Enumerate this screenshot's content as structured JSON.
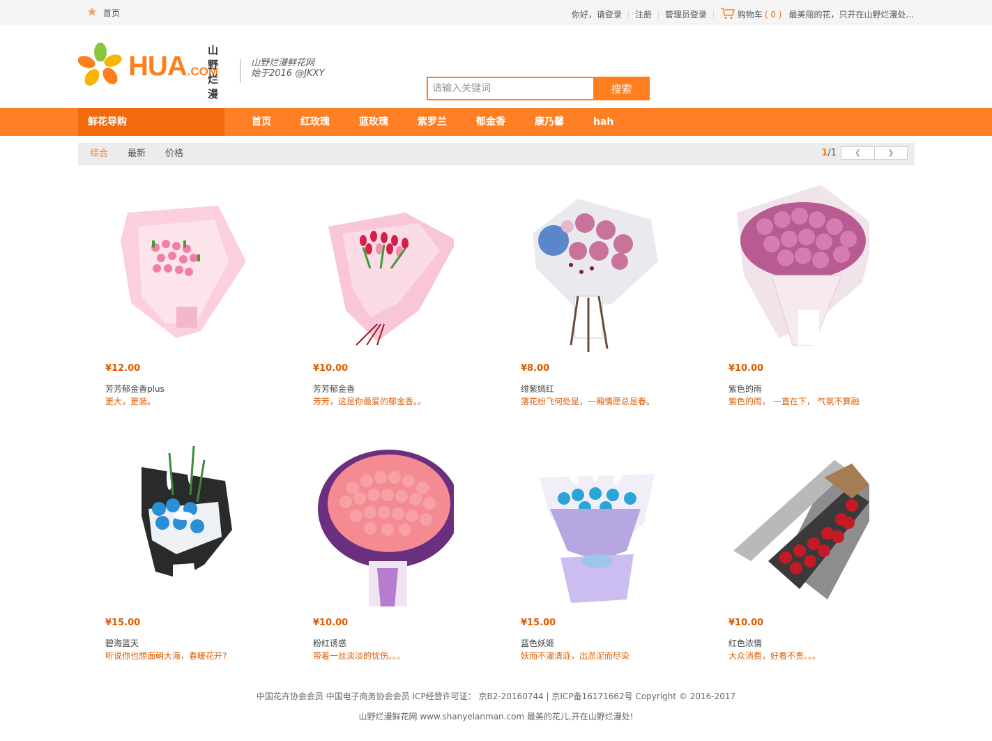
{
  "topbar": {
    "home": "首页",
    "login": "你好，请登录",
    "register": "注册",
    "admin_login": "管理员登录",
    "cart_label": "购物车",
    "cart_count": "( 0 )",
    "tagline": "最美丽的花，只开在山野烂漫处..."
  },
  "logo": {
    "brand": "HUA",
    "domain": ".COM",
    "cn_name": "山野烂漫",
    "slogan_line1": "山野烂漫鲜花网",
    "slogan_line2": "始于2016 @JKXY"
  },
  "search": {
    "placeholder": "请输入关键词",
    "button": "搜索"
  },
  "nav": {
    "guide": "鲜花导购",
    "items": [
      "首页",
      "红玫瑰",
      "蓝玫瑰",
      "紫罗兰",
      "郁金香",
      "康乃馨",
      "hah"
    ]
  },
  "sort": {
    "tabs": [
      "综合",
      "最新",
      "价格"
    ],
    "page_current": "1",
    "page_total": "/1"
  },
  "products": [
    {
      "price": "¥12.00",
      "name": "芳芳郁金香plus",
      "desc": "更大，更装。"
    },
    {
      "price": "¥10.00",
      "name": "芳芳郁金香",
      "desc": "芳芳，这是你最爱的郁金香。。"
    },
    {
      "price": "¥8.00",
      "name": "绯紫嫣红",
      "desc": "落花纷飞何处是，一厢情愿总是春。"
    },
    {
      "price": "¥10.00",
      "name": "紫色的雨",
      "desc": "紫色的雨， 一直在下， 气氛不算融"
    },
    {
      "price": "¥15.00",
      "name": "碧海蓝天",
      "desc": "听说你也想面朝大海，春暖花开?"
    },
    {
      "price": "¥10.00",
      "name": "粉红诱惑",
      "desc": "带着一丝淡淡的忧伤。。。"
    },
    {
      "price": "¥15.00",
      "name": "蓝色妖姬",
      "desc": "妖而不濯清涟，出淤泥而尽染"
    },
    {
      "price": "¥10.00",
      "name": "红色浓情",
      "desc": "大众消费，好看不贵。。。"
    }
  ],
  "footer": {
    "line1": "中国花卉协会会员 中国电子商务协会会员 ICP经营许可证： 京B2-20160744 | 京ICP备16171662号 Copyright © 2016-2017",
    "line2": "山野烂漫鲜花网 www.shanyelanman.com 最美的花儿,开在山野烂漫处!"
  },
  "colors": {
    "accent": "#ff7f24",
    "accent_dark": "#f2690e",
    "price": "#e05b00"
  }
}
